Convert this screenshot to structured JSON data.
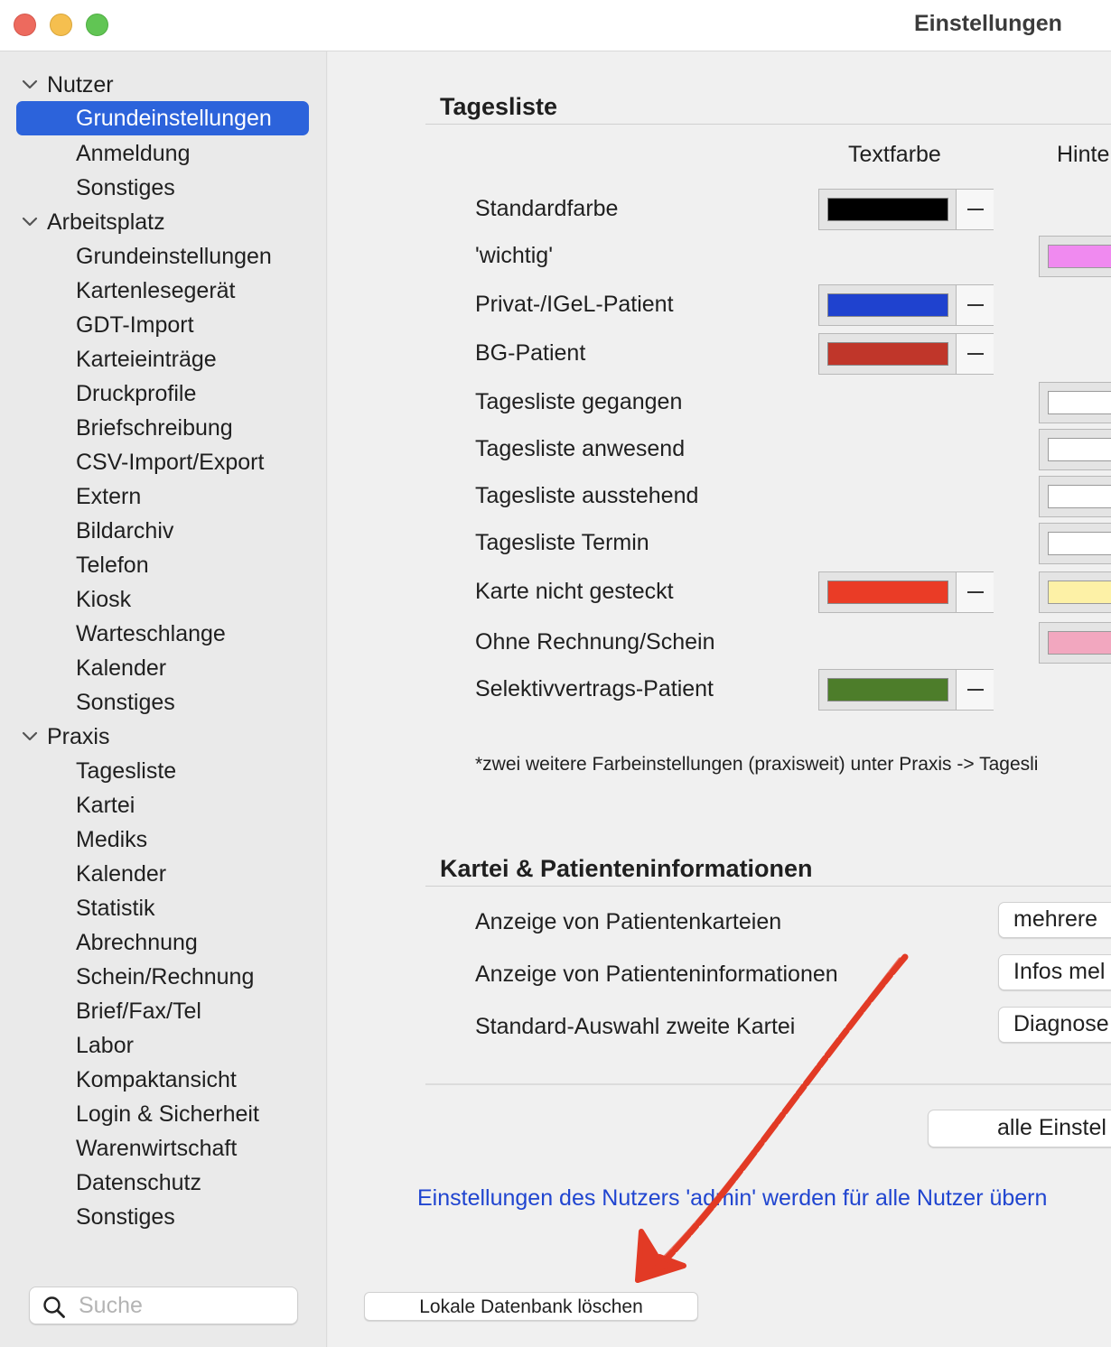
{
  "window": {
    "title": "Einstellungen"
  },
  "sidebar": {
    "groups": [
      {
        "label": "Nutzer",
        "items": [
          "Grundeinstellungen",
          "Anmeldung",
          "Sonstiges"
        ]
      },
      {
        "label": "Arbeitsplatz",
        "items": [
          "Grundeinstellungen",
          "Kartenlesegerät",
          "GDT-Import",
          "Karteieinträge",
          "Druckprofile",
          "Briefschreibung",
          "CSV-Import/Export",
          "Extern",
          "Bildarchiv",
          "Telefon",
          "Kiosk",
          "Warteschlange",
          "Kalender",
          "Sonstiges"
        ]
      },
      {
        "label": "Praxis",
        "items": [
          "Tagesliste",
          "Kartei",
          "Mediks",
          "Kalender",
          "Statistik",
          "Abrechnung",
          "Schein/Rechnung",
          "Brief/Fax/Tel",
          "Labor",
          "Kompaktansicht",
          "Login & Sicherheit",
          "Warenwirtschaft",
          "Datenschutz",
          "Sonstiges"
        ]
      }
    ],
    "selected": "Nutzer / Grundeinstellungen",
    "search": {
      "placeholder": "Suche",
      "value": ""
    }
  },
  "tagesliste": {
    "title": "Tagesliste",
    "columns": {
      "text": "Textfarbe",
      "background": "Hinte"
    },
    "rows": [
      {
        "label": "Standardfarbe",
        "text_color": "#000000",
        "bg_color": null
      },
      {
        "label": "'wichtig'",
        "text_color": null,
        "bg_color": "#f08af0"
      },
      {
        "label": "Privat-/IGeL-Patient",
        "text_color": "#1f42cf",
        "bg_color": null
      },
      {
        "label": "BG-Patient",
        "text_color": "#c0362a",
        "bg_color": null
      },
      {
        "label": "Tagesliste gegangen",
        "text_color": null,
        "bg_color": "#ffffff"
      },
      {
        "label": "Tagesliste anwesend",
        "text_color": null,
        "bg_color": "#ffffff"
      },
      {
        "label": "Tagesliste ausstehend",
        "text_color": null,
        "bg_color": "#ffffff"
      },
      {
        "label": "Tagesliste Termin",
        "text_color": null,
        "bg_color": "#ffffff"
      },
      {
        "label": "Karte nicht gesteckt",
        "text_color": "#ea3c26",
        "bg_color": "#fdf1a6"
      },
      {
        "label": "Ohne Rechnung/Schein",
        "text_color": null,
        "bg_color": "#f2a7bf"
      },
      {
        "label": "Selektivvertrags-Patient",
        "text_color": "#4d7d2a",
        "bg_color": null
      }
    ],
    "note": "*zwei weitere Farbeinstellungen (praxisweit) unter Praxis -> Tagesli"
  },
  "kartei": {
    "title": "Kartei & Patienteninformationen",
    "rows": [
      {
        "label": "Anzeige von Patientenkarteien",
        "value": "mehrere"
      },
      {
        "label": "Anzeige von Patienteninformationen",
        "value": "Infos mel"
      },
      {
        "label": "Standard-Auswahl zweite Kartei",
        "value": "Diagnose"
      }
    ]
  },
  "actions": {
    "apply_all_label": "alle Einstel",
    "info_text": "Einstellungen des Nutzers 'admin' werden für alle Nutzer übern",
    "delete_db_label": "Lokale Datenbank löschen"
  },
  "colors": {
    "accent": "#2c63db",
    "link": "#2045d0",
    "annotation_arrow": "#e23a25"
  }
}
